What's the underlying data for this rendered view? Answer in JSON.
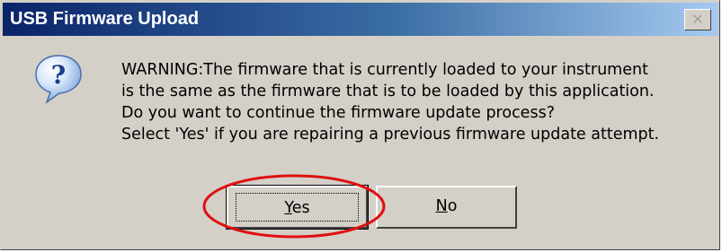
{
  "window": {
    "title": "USB Firmware Upload",
    "close_glyph": "✕"
  },
  "icon": {
    "name": "question-icon",
    "glyph": "?"
  },
  "message": {
    "lines": [
      "WARNING:The firmware that is currently loaded to your instrument",
      "is the same as the firmware that is to be loaded by this application.",
      "Do you want to continue the firmware update process?",
      "Select 'Yes' if you are repairing a previous firmware update attempt."
    ]
  },
  "buttons": {
    "yes": {
      "mnemonic": "Y",
      "rest": "es"
    },
    "no": {
      "mnemonic": "N",
      "rest": "o"
    }
  },
  "colors": {
    "titlebar_start": "#0a246a",
    "titlebar_end": "#a6caf0",
    "dialog_bg": "#d4d0c8",
    "highlight_ellipse": "#e01010"
  }
}
